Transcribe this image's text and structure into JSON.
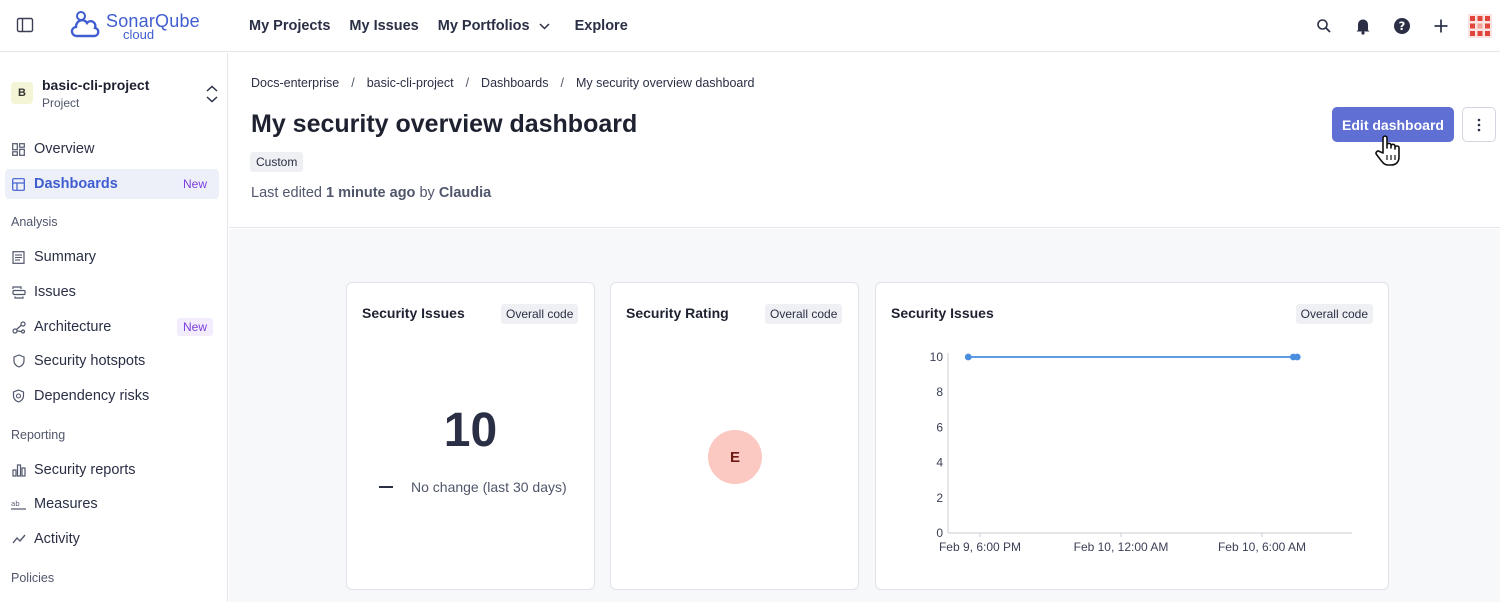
{
  "app": {
    "logo_main": "SonarQube",
    "logo_sub": "cloud",
    "accent": "#3f5dd0"
  },
  "nav": {
    "links": [
      "My Projects",
      "My Issues",
      "My Portfolios",
      "Explore"
    ]
  },
  "project": {
    "avatar_letter": "B",
    "name": "basic-cli-project",
    "type": "Project"
  },
  "sidebar": {
    "items": [
      {
        "label": "Overview",
        "icon": "overview-icon"
      },
      {
        "label": "Dashboards",
        "icon": "dashboard-icon",
        "badge": "New",
        "active": true
      }
    ],
    "analysis_title": "Analysis",
    "analysis": [
      {
        "label": "Summary",
        "icon": "summary-icon"
      },
      {
        "label": "Issues",
        "icon": "issues-icon"
      },
      {
        "label": "Architecture",
        "icon": "architecture-icon",
        "badge": "New"
      },
      {
        "label": "Security hotspots",
        "icon": "shield-icon"
      },
      {
        "label": "Dependency risks",
        "icon": "dependency-icon"
      }
    ],
    "reporting_title": "Reporting",
    "reporting": [
      {
        "label": "Security reports",
        "icon": "bar-chart-icon"
      },
      {
        "label": "Measures",
        "icon": "measures-icon"
      },
      {
        "label": "Activity",
        "icon": "activity-icon"
      }
    ],
    "policies_title": "Policies"
  },
  "breadcrumb": [
    "Docs-enterprise",
    "basic-cli-project",
    "Dashboards",
    "My security overview dashboard"
  ],
  "page": {
    "title": "My security overview dashboard",
    "tag": "Custom",
    "last_edited_prefix": "Last edited",
    "last_edited_time": "1 minute ago",
    "last_edited_by": "by",
    "last_edited_user": "Claudia",
    "edit_button": "Edit dashboard"
  },
  "cards": {
    "issues": {
      "title": "Security Issues",
      "tag": "Overall code",
      "value": "10",
      "change_text": "No change (last 30 days)"
    },
    "rating": {
      "title": "Security Rating",
      "tag": "Overall code",
      "value": "E",
      "color": "#fcc8c2"
    },
    "trend": {
      "title": "Security Issues",
      "tag": "Overall code"
    }
  },
  "chart_data": {
    "type": "line",
    "title": "Security Issues",
    "x": [
      "Feb 9, 5:30 PM",
      "Feb 10, 7:20 AM",
      "Feb 10, 7:30 AM"
    ],
    "x_tick_labels": [
      "Feb 9, 6:00 PM",
      "Feb 10, 12:00 AM",
      "Feb 10, 6:00 AM"
    ],
    "series": [
      {
        "values": [
          10,
          10,
          10
        ],
        "color": "#4a8ee0"
      }
    ],
    "y_ticks": [
      0,
      2,
      4,
      6,
      8,
      10
    ],
    "ylim": [
      0,
      10
    ],
    "grid": false
  }
}
